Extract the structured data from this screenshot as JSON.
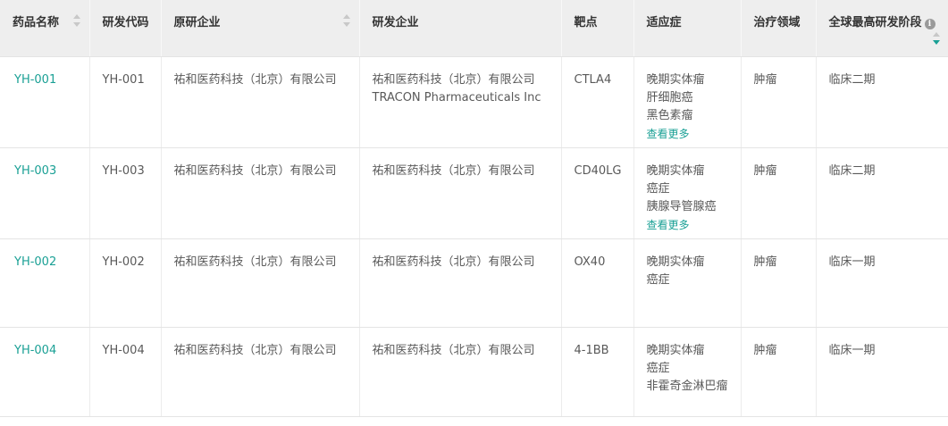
{
  "colors": {
    "header_bg": "#eeeeee",
    "link": "#1aa095",
    "text": "#595959",
    "header_text": "#333333",
    "sort_inactive": "#c8c8c8"
  },
  "table": {
    "headers": {
      "drug_name": "药品名称",
      "dev_code": "研发代码",
      "original_company": "原研企业",
      "dev_company": "研发企业",
      "target": "靶点",
      "indication": "适应症",
      "therapeutic_area": "治疗领域",
      "global_phase": "全球最高研发阶段"
    },
    "more_label": "查看更多",
    "rows": [
      {
        "drug_name": "YH-001",
        "dev_code": "YH-001",
        "original_company": "祐和医药科技（北京）有限公司",
        "dev_companies": [
          "祐和医药科技（北京）有限公司",
          "TRACON Pharmaceuticals Inc"
        ],
        "target": "CTLA4",
        "indications": [
          "晚期实体瘤",
          "肝细胞癌",
          "黑色素瘤"
        ],
        "show_more": "查看更多",
        "therapeutic_area": "肿瘤",
        "phase": "临床二期"
      },
      {
        "drug_name": "YH-003",
        "dev_code": "YH-003",
        "original_company": "祐和医药科技（北京）有限公司",
        "dev_companies": [
          "祐和医药科技（北京）有限公司"
        ],
        "target": "CD40LG",
        "indications": [
          "晚期实体瘤",
          "癌症",
          "胰腺导管腺癌"
        ],
        "show_more": "查看更多",
        "therapeutic_area": "肿瘤",
        "phase": "临床二期"
      },
      {
        "drug_name": "YH-002",
        "dev_code": "YH-002",
        "original_company": "祐和医药科技（北京）有限公司",
        "dev_companies": [
          "祐和医药科技（北京）有限公司"
        ],
        "target": "OX40",
        "indications": [
          "晚期实体瘤",
          "癌症"
        ],
        "show_more": "",
        "therapeutic_area": "肿瘤",
        "phase": "临床一期"
      },
      {
        "drug_name": "YH-004",
        "dev_code": "YH-004",
        "original_company": "祐和医药科技（北京）有限公司",
        "dev_companies": [
          "祐和医药科技（北京）有限公司"
        ],
        "target": "4-1BB",
        "indications": [
          "晚期实体瘤",
          "癌症",
          "非霍奇金淋巴瘤"
        ],
        "show_more": "",
        "therapeutic_area": "肿瘤",
        "phase": "临床一期"
      }
    ]
  }
}
